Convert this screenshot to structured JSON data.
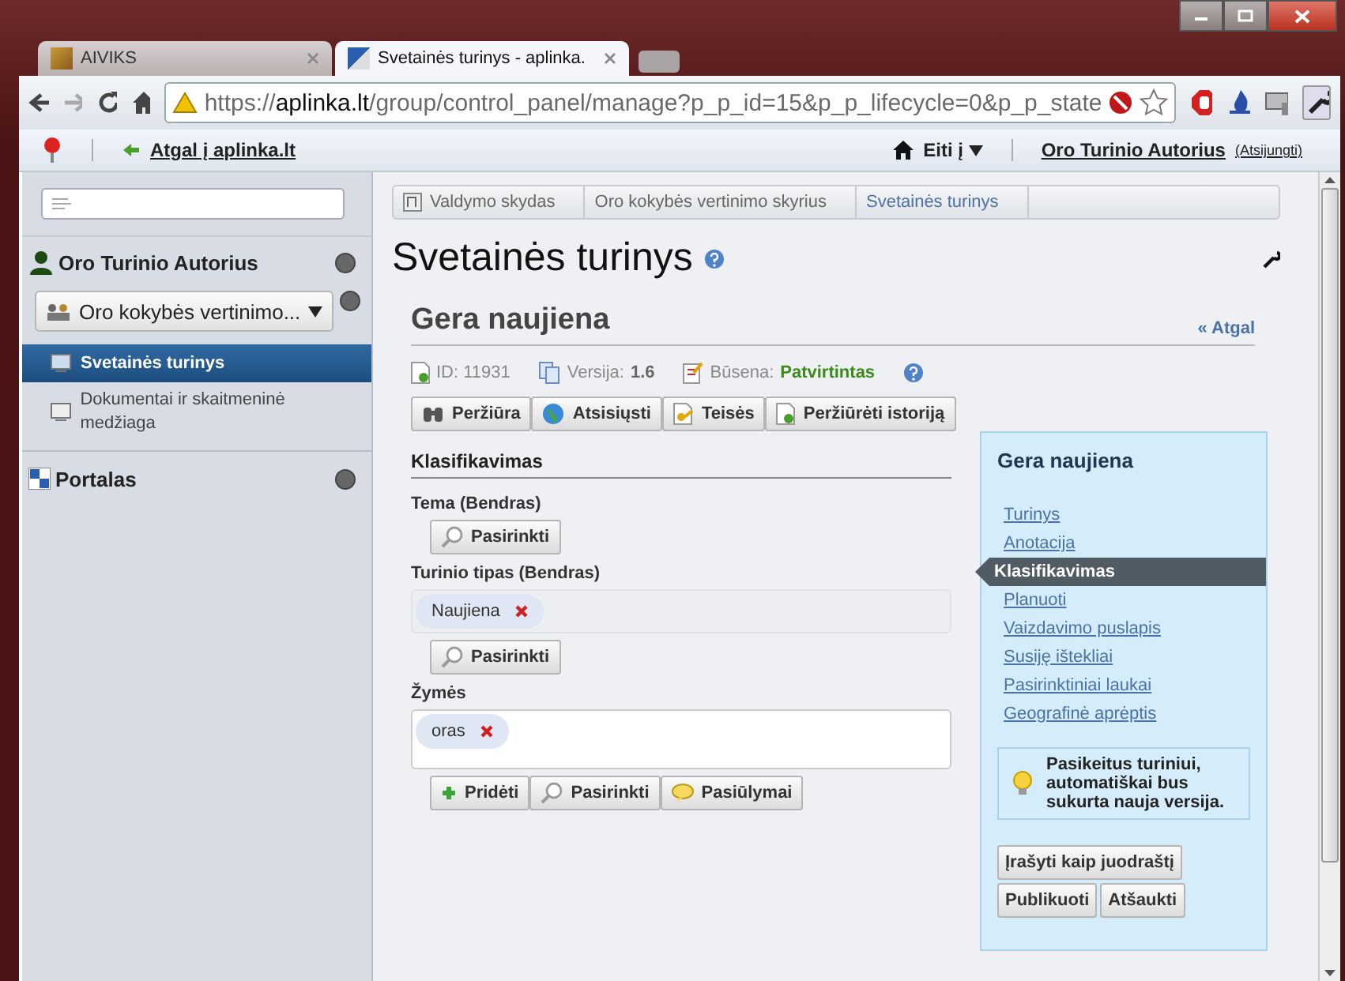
{
  "browser": {
    "tabs": [
      {
        "title": "AIVIKS",
        "selected": false
      },
      {
        "title": "Svetainės turinys - aplinka.",
        "selected": true
      }
    ],
    "url": {
      "scheme": "https://",
      "host": "aplinka.lt",
      "path": "/group/control_panel/manage?p_p_id=15&p_p_lifecycle=0&p_p_state"
    }
  },
  "dockbar": {
    "back_link": "Atgal į aplinka.lt",
    "goto": "Eiti į",
    "user": "Oro Turinio Autorius",
    "logout": "(Atsijungti)"
  },
  "sidebar": {
    "user_name": "Oro Turinio Autorius",
    "site_selector": "Oro kokybės vertinimo...",
    "items": [
      {
        "label": "Svetainės turinys",
        "selected": true
      },
      {
        "label": "Dokumentai ir skaitmeninė medžiaga",
        "selected": false
      }
    ],
    "portal": "Portalas"
  },
  "breadcrumb": [
    "Valdymo skydas",
    "Oro kokybės vertinimo skyrius",
    "Svetainės turinys"
  ],
  "page_title": "Svetainės turinys",
  "article": {
    "title": "Gera naujiena",
    "back": "« Atgal",
    "id_label": "ID:",
    "id": "11931",
    "version_label": "Versija:",
    "version": "1.6",
    "status_label": "Būsena:",
    "status": "Patvirtintas",
    "toolbar": [
      "Peržiūra",
      "Atsisiųsti",
      "Teisės",
      "Peržiūrėti istoriją"
    ]
  },
  "classification": {
    "title": "Klasifikavimas",
    "fields": [
      {
        "label": "Tema (Bendras)",
        "kind": "select",
        "buttons": [
          "Pasirinkti"
        ]
      },
      {
        "label": "Turinio tipas (Bendras)",
        "kind": "select",
        "tags": [
          "Naujiena"
        ],
        "buttons": [
          "Pasirinkti"
        ]
      },
      {
        "label": "Žymės",
        "kind": "tags",
        "tags": [
          "oras"
        ],
        "buttons": [
          "Pridėti",
          "Pasirinkti",
          "Pasiūlymai"
        ]
      }
    ]
  },
  "panel": {
    "title": "Gera naujiena",
    "items": [
      {
        "label": "Turinys",
        "selected": false
      },
      {
        "label": "Anotacija",
        "selected": false
      },
      {
        "label": "Klasifikavimas",
        "selected": true
      },
      {
        "label": "Planuoti",
        "selected": false
      },
      {
        "label": "Vaizdavimo puslapis",
        "selected": false
      },
      {
        "label": "Susiję ištekliai",
        "selected": false
      },
      {
        "label": "Pasirinktiniai laukai",
        "selected": false
      },
      {
        "label": "Geografinė aprėptis",
        "selected": false
      }
    ],
    "note": "Pasikeitus turiniui, automatiškai bus sukurta nauja versija.",
    "buttons": [
      "Įrašyti kaip juodraštį",
      "Publikuoti",
      "Atšaukti"
    ]
  }
}
